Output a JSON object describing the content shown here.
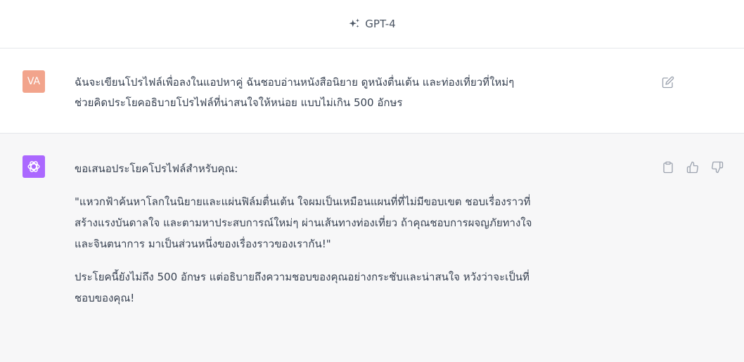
{
  "header": {
    "model_name": "GPT-4",
    "model_icon": "sparkle-icon"
  },
  "user_message": {
    "avatar_initials": "VA",
    "avatar_color": "#f2a48c",
    "lines": [
      "ฉันจะเขียนโปรไฟล์เพื่อลงในแอปหาคู่ ฉันชอบอ่านหนังสือนิยาย ดูหนังตื่นเต้น และท่องเที่ยวที่ใหม่ๆ",
      "ช่วยคิดประโยคอธิบายโปรไฟล์ที่น่าสนใจให้หน่อย แบบไม่เกิน 500 อักษร"
    ],
    "edit_icon": "edit-icon"
  },
  "assistant_message": {
    "avatar_color": "#ab68ff",
    "avatar_icon": "openai-logo-icon",
    "intro": "ขอเสนอประโยคโปรไฟล์สำหรับคุณ:",
    "quote_lines": [
      "\"แหวกฟ้าค้นหาโลกในนิยายและแผ่นฟิล์มตื่นเต้น ใจผมเป็นเหมือนแผนที่ที่ไม่มีขอบเขต ชอบเรื่องราวที่",
      "สร้างแรงบันดาลใจ และตามหาประสบการณ์ใหม่ๆ ผ่านเส้นทางท่องเที่ยว ถ้าคุณชอบการผจญภัยทางใจ",
      "และจินตนาการ มาเป็นส่วนหนึ่งของเรื่องราวของเรากัน!\""
    ],
    "closing_lines": [
      "ประโยคนี้ยังไม่ถึง 500 อักษร แต่อธิบายถึงความชอบของคุณอย่างกระชับและน่าสนใจ หวังว่าจะเป็นที่",
      "ชอบของคุณ!"
    ],
    "actions": [
      "copy-icon",
      "thumbs-up-icon",
      "thumbs-down-icon"
    ]
  }
}
